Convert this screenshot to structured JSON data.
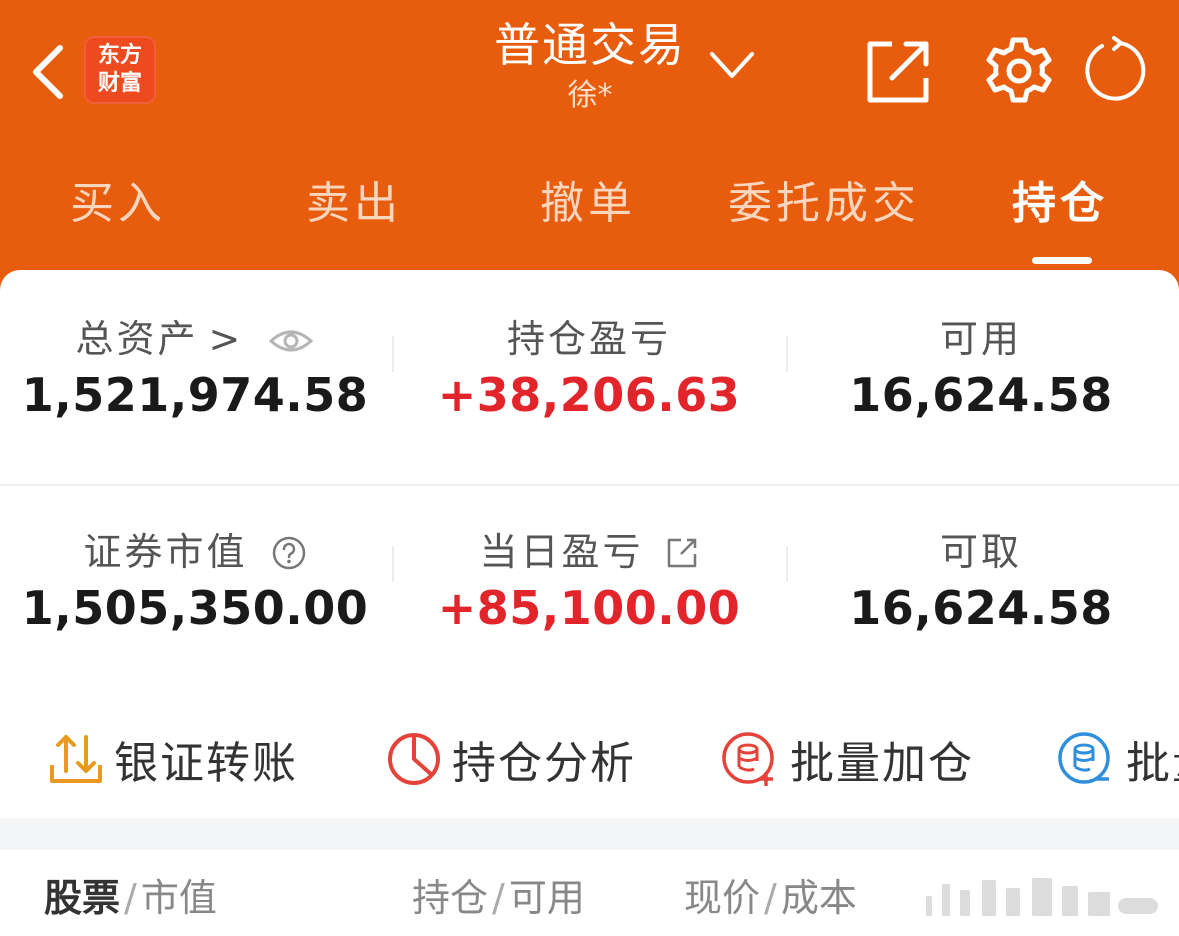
{
  "colors": {
    "brand_orange": "#e85c0d",
    "logo_red": "#ee4a1f",
    "profit_red": "#e2242b",
    "transfer_orange": "#e99a1e",
    "analysis_red": "#e5433a",
    "batch_blue": "#2f8fdc"
  },
  "header": {
    "logo_line1": "东方",
    "logo_line2": "财富",
    "title": "普通交易",
    "account": "徐*",
    "icons": [
      "back-arrow-icon",
      "chevron-down-icon",
      "share-icon",
      "gear-icon",
      "refresh-icon"
    ]
  },
  "tabs": [
    "买入",
    "卖出",
    "撤单",
    "委托成交",
    "持仓"
  ],
  "active_tab": "持仓",
  "summary": {
    "total_assets_label": "总资产",
    "total_assets_arrow": ">",
    "total_assets_value": "1,521,974.58",
    "position_pl_label": "持仓盈亏",
    "position_pl_value": "+38,206.63",
    "available_label": "可用",
    "available_value": "16,624.58",
    "securities_value_label": "证券市值",
    "securities_value_value": "1,505,350.00",
    "daily_pl_label": "当日盈亏",
    "daily_pl_value": "+85,100.00",
    "withdrawable_label": "可取",
    "withdrawable_value": "16,624.58"
  },
  "actions": [
    {
      "label": "银证转账",
      "icon": "transfer-icon"
    },
    {
      "label": "持仓分析",
      "icon": "pie-chart-icon"
    },
    {
      "label": "批量加仓",
      "icon": "batch-add-icon"
    },
    {
      "label": "批量",
      "icon": "batch-reduce-icon"
    }
  ],
  "columns": {
    "col1_main": "股票",
    "col1_sub": "市值",
    "col2_main": "持仓",
    "col2_sub": "可用",
    "col3_main": "现价",
    "col3_sub": "成本",
    "separator": "/"
  }
}
